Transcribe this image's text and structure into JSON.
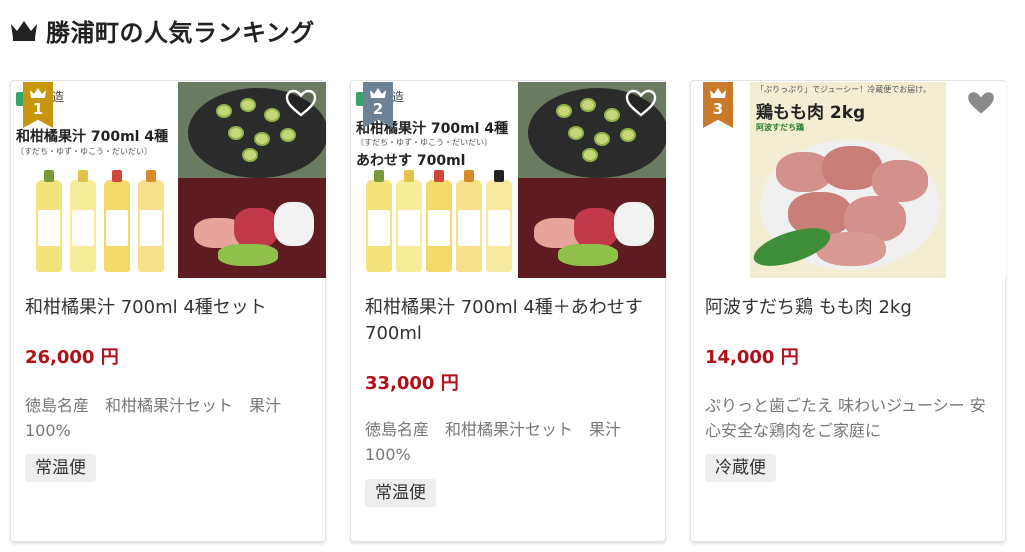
{
  "section": {
    "title": "勝浦町の人気ランキング",
    "icon": "crown-icon"
  },
  "colors": {
    "price": "#b0101a",
    "rank_1": "#c8960c",
    "rank_2": "#6d8296",
    "rank_3": "#c97a2a"
  },
  "cards": [
    {
      "rank": "1",
      "thumb_text": {
        "logo": "造",
        "title": "和柑橘果汁 700ml 4種",
        "sub": "〔すだち・ゆず・ゆこう・だいだい〕"
      },
      "name": "和柑橘果汁 700ml 4種セット",
      "price": "26,000 円",
      "description": "徳島名産　和柑橘果汁セット　果汁100%",
      "tag": "常温便"
    },
    {
      "rank": "2",
      "thumb_text": {
        "logo": "造",
        "title": "和柑橘果汁 700ml 4種",
        "sub": "〔すだち・ゆず・ゆこう・だいだい〕",
        "title2": "あわせす 700ml"
      },
      "name": "和柑橘果汁 700ml 4種＋あわせす 700ml",
      "price": "33,000 円",
      "description": "徳島名産　和柑橘果汁セット　果汁100%",
      "tag": "常温便"
    },
    {
      "rank": "3",
      "thumb_text": {
        "top": "「ぷりっぷり」でジューシー！冷蔵便でお届け。",
        "title": "鶏もも肉 2kg",
        "brand": "阿波すだち鶏"
      },
      "name": "阿波すだち鶏 もも肉 2kg",
      "price": "14,000 円",
      "description": "ぷりっと歯ごたえ 味わいジューシー 安心安全な鶏肉をご家庭に",
      "tag": "冷蔵便"
    }
  ]
}
